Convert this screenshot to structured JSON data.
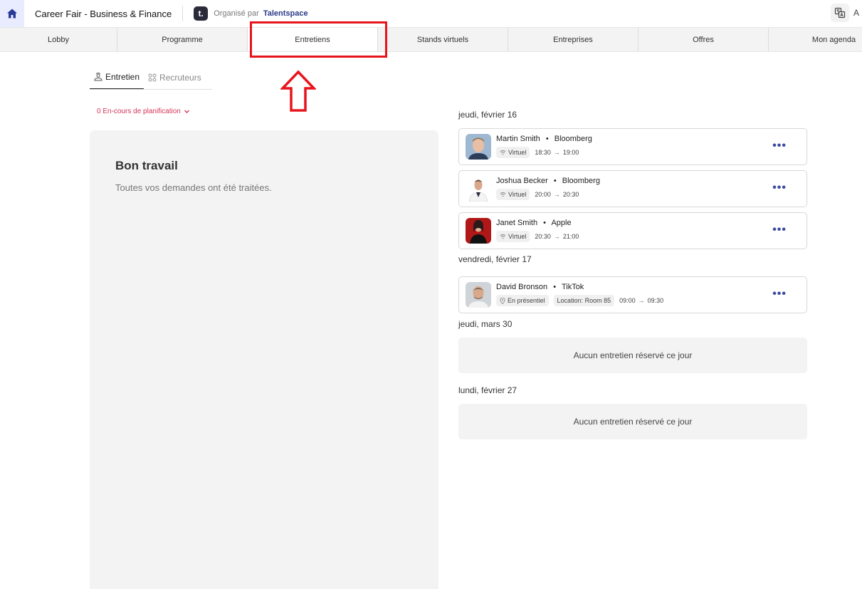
{
  "header": {
    "event_title": "Career Fair - Business & Finance",
    "org_prefix": "Organisé par",
    "org_name": "Talentspace",
    "org_logo_letter": "t.",
    "cut_off_icon_char": "A"
  },
  "tabs": [
    {
      "label": "Lobby"
    },
    {
      "label": "Programme"
    },
    {
      "label": "Entretiens",
      "active": true
    },
    {
      "label": "Stands virtuels"
    },
    {
      "label": "Entreprises"
    },
    {
      "label": "Offres"
    },
    {
      "label": "Mon agenda"
    }
  ],
  "subtabs": {
    "interview": "Entretien",
    "recruiters": "Recruteurs"
  },
  "filter": {
    "label": "0 En-cours de planification"
  },
  "left_panel": {
    "title": "Bon travail",
    "subtitle": "Toutes vos demandes ont été traitées."
  },
  "days": [
    {
      "label": "jeudi, février 16",
      "interviews": [
        {
          "name": "Martin Smith",
          "company": "Bloomberg",
          "mode": "Virtuel",
          "start": "18:30",
          "end": "19:00"
        },
        {
          "name": "Joshua Becker",
          "company": "Bloomberg",
          "mode": "Virtuel",
          "start": "20:00",
          "end": "20:30"
        },
        {
          "name": "Janet Smith",
          "company": "Apple",
          "mode": "Virtuel",
          "start": "20:30",
          "end": "21:00"
        }
      ]
    },
    {
      "label": "vendredi, février 17",
      "interviews": [
        {
          "name": "David Bronson",
          "company": "TikTok",
          "mode": "En présentiel",
          "location": "Location: Room 85",
          "start": "09:00",
          "end": "09:30"
        }
      ]
    },
    {
      "label": "jeudi, mars 30",
      "empty_text": "Aucun entretien réservé ce jour"
    },
    {
      "label": "lundi, février 27",
      "empty_text": "Aucun entretien réservé ce jour"
    }
  ],
  "misc": {
    "separator": "•",
    "arrow": "→",
    "more": "•••"
  },
  "colors": {
    "accent": "#3a4aa0",
    "highlight": "#e8141c",
    "filter": "#d6345a"
  }
}
